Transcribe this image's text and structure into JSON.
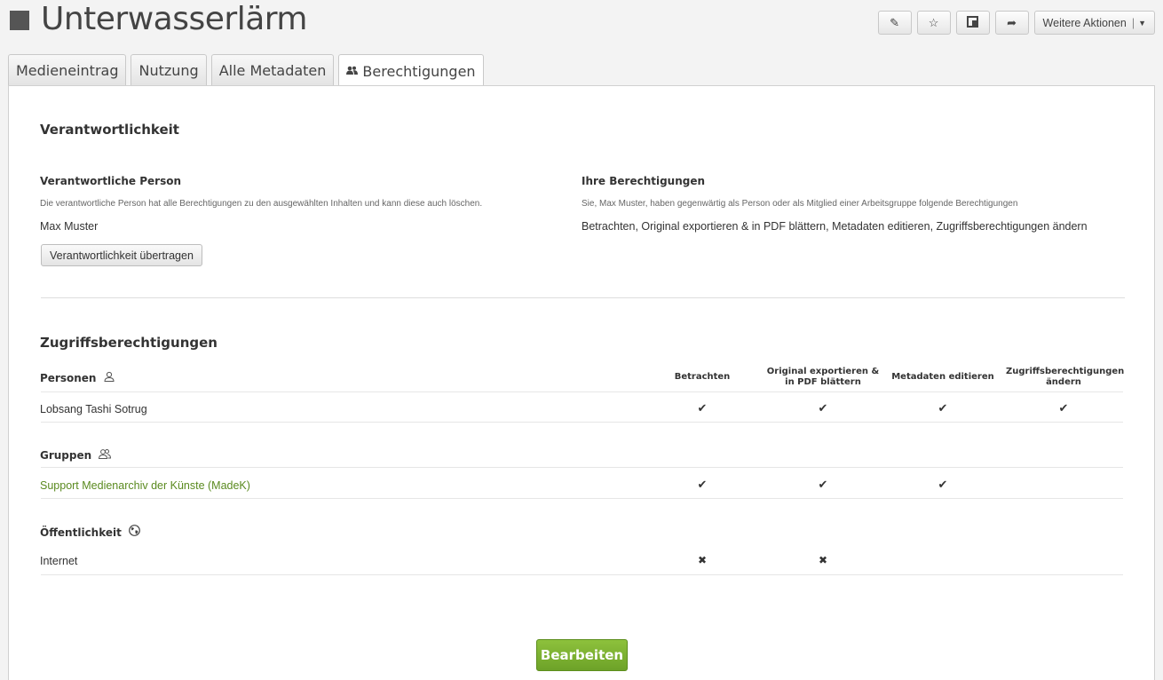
{
  "header": {
    "title": "Unterwasserlärm",
    "toolbar": {
      "more_label": "Weitere Aktionen",
      "more_separator": "|"
    }
  },
  "tabs": [
    {
      "label": "Medieneintrag"
    },
    {
      "label": "Nutzung"
    },
    {
      "label": "Alle Metadaten"
    },
    {
      "label": "Berechtigungen"
    }
  ],
  "responsibility": {
    "heading": "Verantwortlichkeit",
    "person_label": "Verantwortliche Person",
    "person_hint": "Die verantwortliche Person hat alle Berechtigungen zu den ausgewählten Inhalten und kann diese auch löschen.",
    "person_name": "Max Muster",
    "transfer_button": "Verantwortlichkeit übertragen",
    "your_permissions_label": "Ihre Berechtigungen",
    "your_permissions_hint": "Sie, Max Muster, haben gegenwärtig als Person oder als Mitglied einer Arbeitsgruppe folgende Berechtigungen",
    "your_permissions_value": "Betrachten, Original exportieren & in PDF blättern, Metadaten editieren, Zugriffsberechtigungen ändern"
  },
  "access": {
    "heading": "Zugriffsberechtigungen",
    "columns": [
      "Betrachten",
      "Original exportieren & in PDF blättern",
      "Metadaten editieren",
      "Zugriffsberechtigungen ändern"
    ],
    "groups": [
      {
        "label": "Personen",
        "icon": "person-icon",
        "rows": [
          {
            "name": "Lobsang Tashi Sotrug",
            "perms": [
              "check",
              "check",
              "check",
              "check"
            ]
          }
        ]
      },
      {
        "label": "Gruppen",
        "icon": "group-icon",
        "rows": [
          {
            "name": "Support Medienarchiv der Künste (MadeK)",
            "perms": [
              "check",
              "check",
              "check",
              ""
            ]
          }
        ]
      },
      {
        "label": "Öffentlichkeit",
        "icon": "globe-icon",
        "rows": [
          {
            "name": "Internet",
            "perms": [
              "cross",
              "cross",
              "",
              ""
            ]
          }
        ]
      }
    ],
    "glyphs": {
      "check": "✔",
      "cross": "✖"
    },
    "edit_button": "Bearbeiten"
  },
  "colors": {
    "accent_green": "#6da228",
    "link_green": "#5a8a1f"
  }
}
